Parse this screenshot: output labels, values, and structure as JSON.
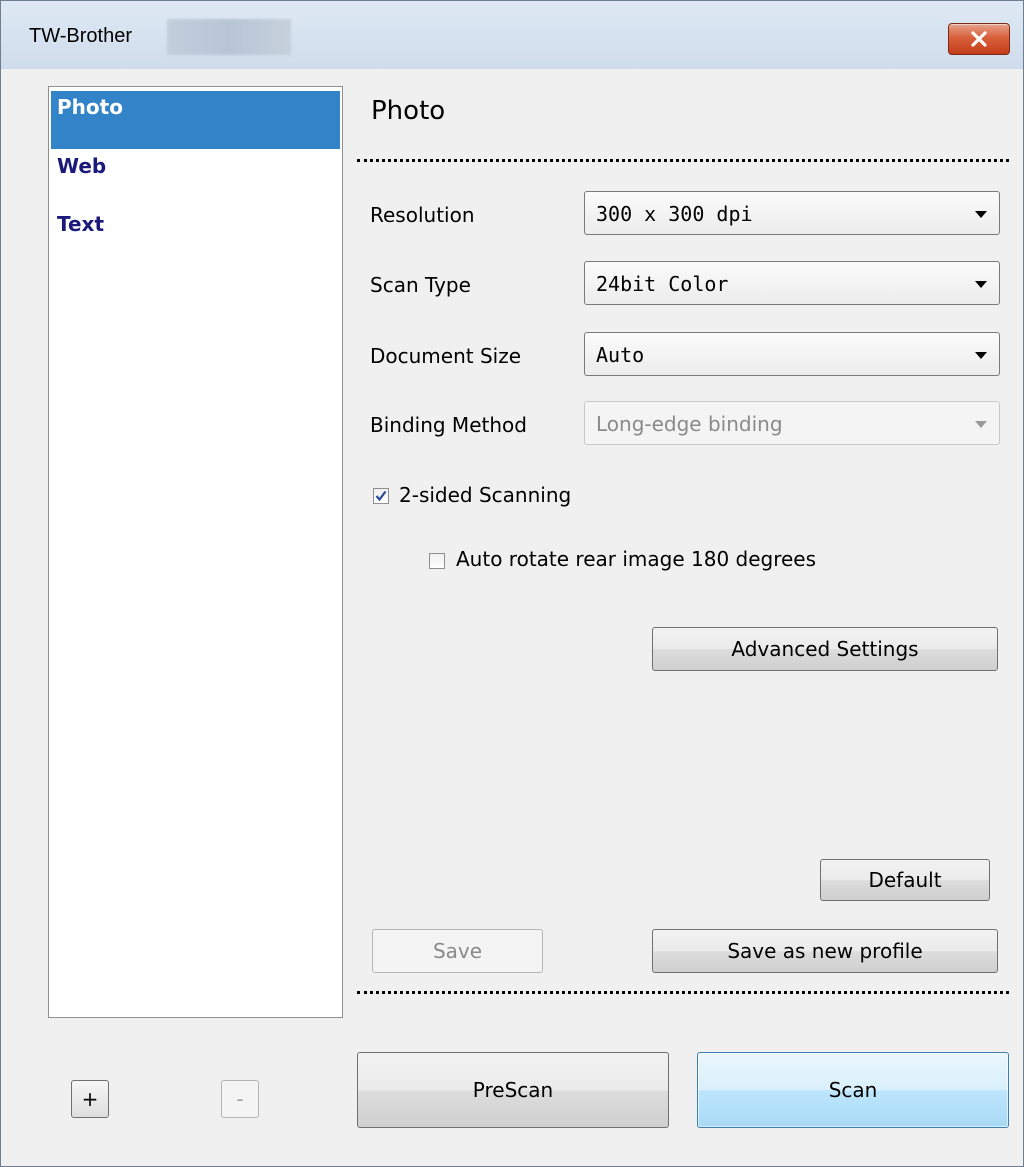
{
  "window": {
    "title": "TW-Brother"
  },
  "profiles": {
    "items": [
      {
        "label": "Photo",
        "selected": true
      },
      {
        "label": "Web",
        "selected": false
      },
      {
        "label": "Text",
        "selected": false
      }
    ],
    "add_label": "+",
    "remove_label": "-"
  },
  "settings": {
    "section_title": "Photo",
    "resolution": {
      "label": "Resolution",
      "value": "300 x 300 dpi"
    },
    "scan_type": {
      "label": "Scan Type",
      "value": "24bit Color"
    },
    "document_size": {
      "label": "Document Size",
      "value": "Auto"
    },
    "binding_method": {
      "label": "Binding Method",
      "value": "Long-edge binding",
      "enabled": false
    },
    "two_sided": {
      "label": "2-sided Scanning",
      "checked": true
    },
    "auto_rotate": {
      "label": "Auto rotate rear image 180 degrees",
      "checked": false
    },
    "advanced_label": "Advanced Settings",
    "default_label": "Default",
    "save_label": "Save",
    "save_new_label": "Save as new profile"
  },
  "actions": {
    "prescan_label": "PreScan",
    "scan_label": "Scan"
  },
  "colors": {
    "selection": "#3283c8",
    "profile_text": "#1a1a7a",
    "close_button": "#c94a28",
    "primary_button_border": "#3c7fb1"
  }
}
